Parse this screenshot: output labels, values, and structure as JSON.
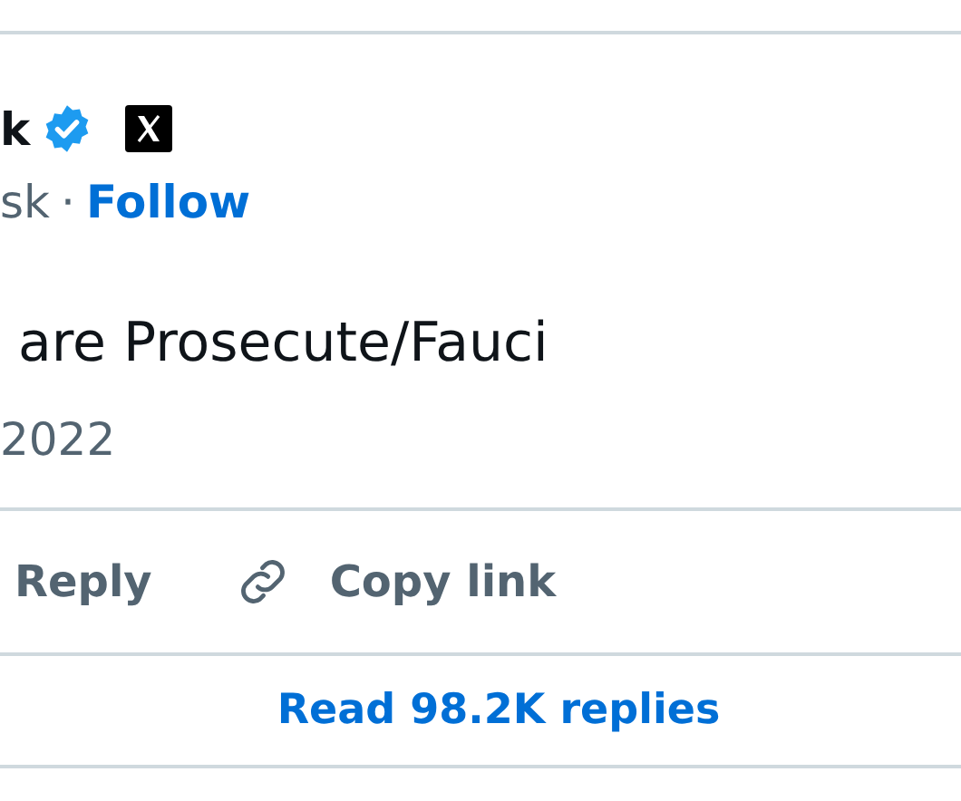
{
  "author": {
    "name": "k",
    "handle": "sk",
    "separator": "·",
    "follow": "Follow",
    "verified": true
  },
  "tweet": {
    "text": "are Prosecute/Fauci",
    "date": "2022"
  },
  "actions": [
    {
      "kind": "reply",
      "label": "Reply"
    },
    {
      "kind": "link",
      "label": "Copy link"
    }
  ],
  "read_replies": "Read 98.2K replies"
}
